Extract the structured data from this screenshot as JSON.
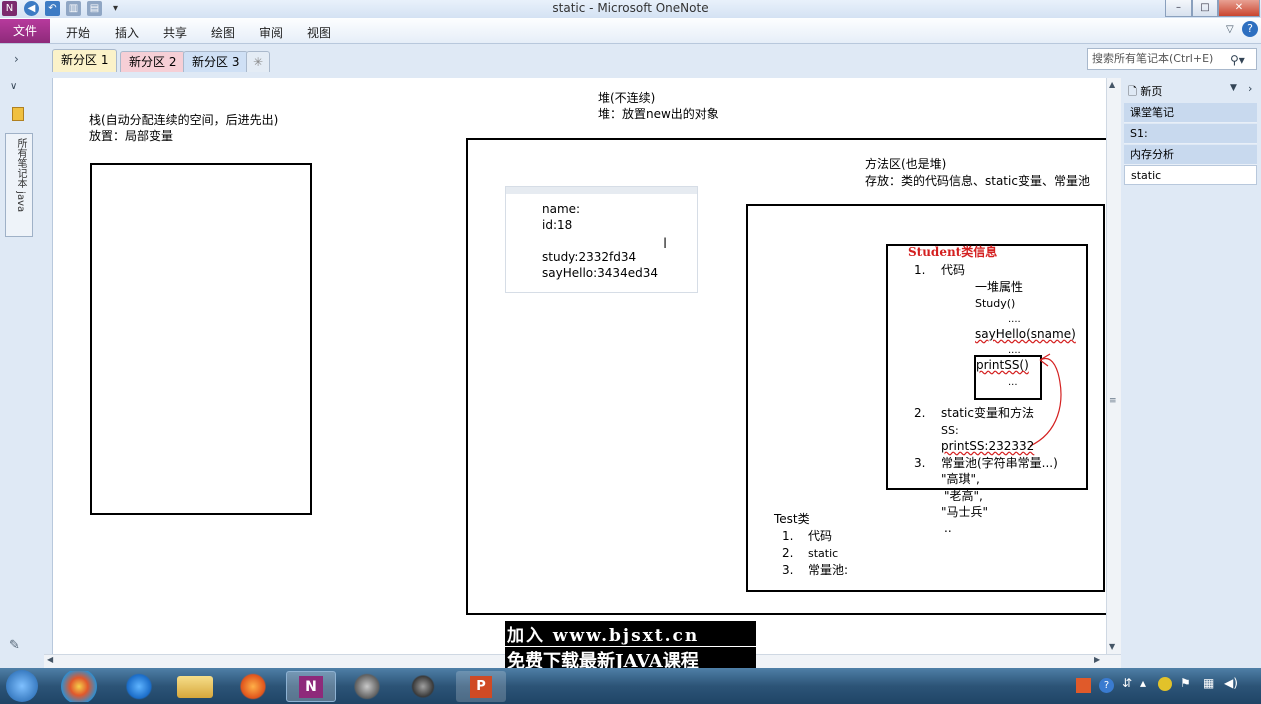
{
  "window": {
    "title": "static - Microsoft OneNote",
    "controls": [
      "–",
      "□",
      "✕"
    ]
  },
  "ribbon": {
    "file": "文件",
    "tabs": [
      "开始",
      "插入",
      "共享",
      "绘图",
      "审阅",
      "视图"
    ]
  },
  "sections": {
    "tabs": [
      "新分区 1",
      "新分区 2",
      "新分区 3"
    ],
    "colors": [
      "#fbf2c9",
      "#f6cfd6",
      "#cfe0f5"
    ],
    "new_tab": "✳"
  },
  "search": {
    "placeholder": "搜索所有笔记本(Ctrl+E)"
  },
  "left_nav": {
    "label": "所有笔记本 java"
  },
  "pages_pane": {
    "new_page": "新页",
    "items": [
      "课堂笔记",
      "S1:",
      "内存分析",
      "static"
    ]
  },
  "note": {
    "stack_title": "栈(自动分配连续的空间，后进先出)",
    "stack_put": "放置：局部变量",
    "heap_title": "堆(不连续)",
    "heap_put": "堆：放置new出的对象",
    "method_title": "方法区(也是堆)",
    "method_put": "存放：类的代码信息、static变量、常量池",
    "object": {
      "name": "name:",
      "id": "id:18",
      "study": "study:2332fd34",
      "sayhello": "sayHello:3434ed34"
    },
    "student": {
      "title": "Student类信息",
      "n1": "1.",
      "code": "代码",
      "props": "一堆属性",
      "study": "Study()",
      "dots1": "....",
      "sayhello": "sayHello(sname)",
      "dots2": "....",
      "prints": "printSS()",
      "dots3": "...",
      "n2": "2.",
      "static_vars": "static变量和方法",
      "ss": "SS:",
      "printss_val": "printSS:232332",
      "n3": "3.",
      "pool": "常量池(字符串常量...)",
      "s1": "\"高琪\",",
      "s2": "\"老高\",",
      "s3": "\"马士兵\"",
      "dots4": ".."
    },
    "test": {
      "title": "Test类",
      "items": [
        "1.",
        "代码",
        "2.",
        "static",
        "3.",
        "常量池:"
      ]
    }
  },
  "watermark": {
    "line1": "加入 www.bjsxt.cn",
    "line2": "免费下载最新JAVA课程"
  },
  "taskbar": {
    "apps": [
      "start-orb-icon",
      "explorer-multi-icon",
      "ie-icon",
      "folder-icon",
      "firefox-icon",
      "onenote-icon",
      "java-ee-icon",
      "camera-icon",
      "powerpoint-icon"
    ]
  }
}
